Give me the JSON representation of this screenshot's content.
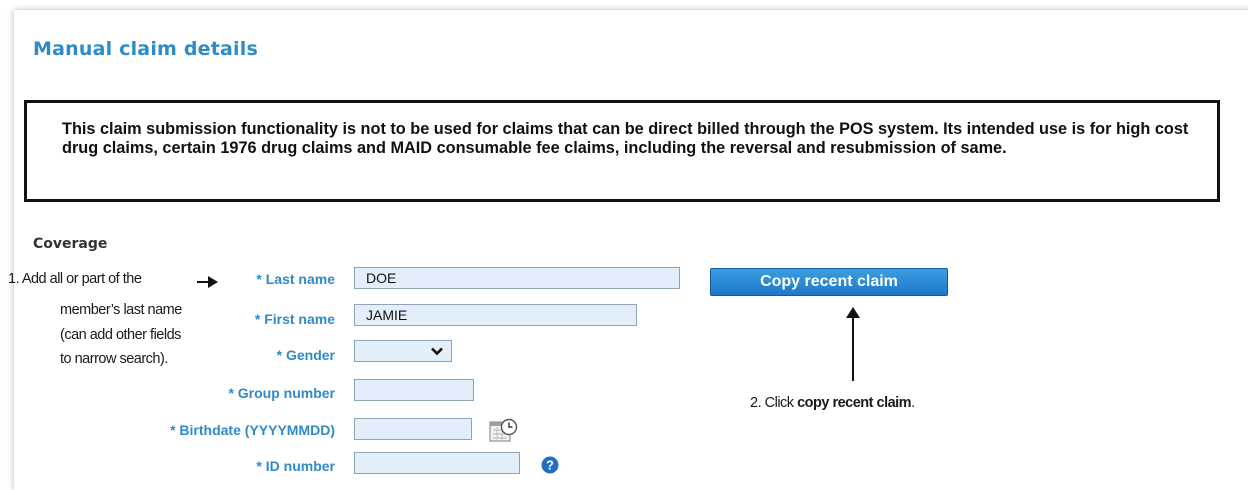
{
  "page": {
    "title": "Manual claim details"
  },
  "notice": {
    "text": "This claim submission functionality is not to be used for claims that can be direct billed through the POS system. Its intended use is for high cost drug claims, certain 1976 drug claims and MAID consumable fee claims, including the reversal and resubmission of same."
  },
  "coverage": {
    "heading": "Coverage",
    "fields": {
      "last_name": {
        "label": "* Last name",
        "value": "DOE"
      },
      "first_name": {
        "label": "* First name",
        "value": "JAMIE"
      },
      "gender": {
        "label": "* Gender",
        "value": ""
      },
      "group_number": {
        "label": "* Group number",
        "value": ""
      },
      "birthdate": {
        "label": "* Birthdate (YYYYMMDD)",
        "value": ""
      },
      "id_number": {
        "label": "* ID number",
        "value": ""
      }
    },
    "copy_button": "Copy recent claim"
  },
  "annotations": {
    "step1": {
      "line1": "1.  Add all or part of the",
      "line2": "member’s last name",
      "line3": "(can add other fields",
      "line4": "to narrow search)."
    },
    "step2": {
      "prefix": "2.  Click ",
      "bold": "copy recent claim",
      "suffix": "."
    }
  },
  "icons": {
    "calendar": "calendar-icon",
    "help": "help-icon",
    "dropdown": "chevron-down-icon"
  },
  "colors": {
    "accent": "#2e8bc8",
    "button": "#1e78c8",
    "input_bg": "#e2eef9"
  }
}
